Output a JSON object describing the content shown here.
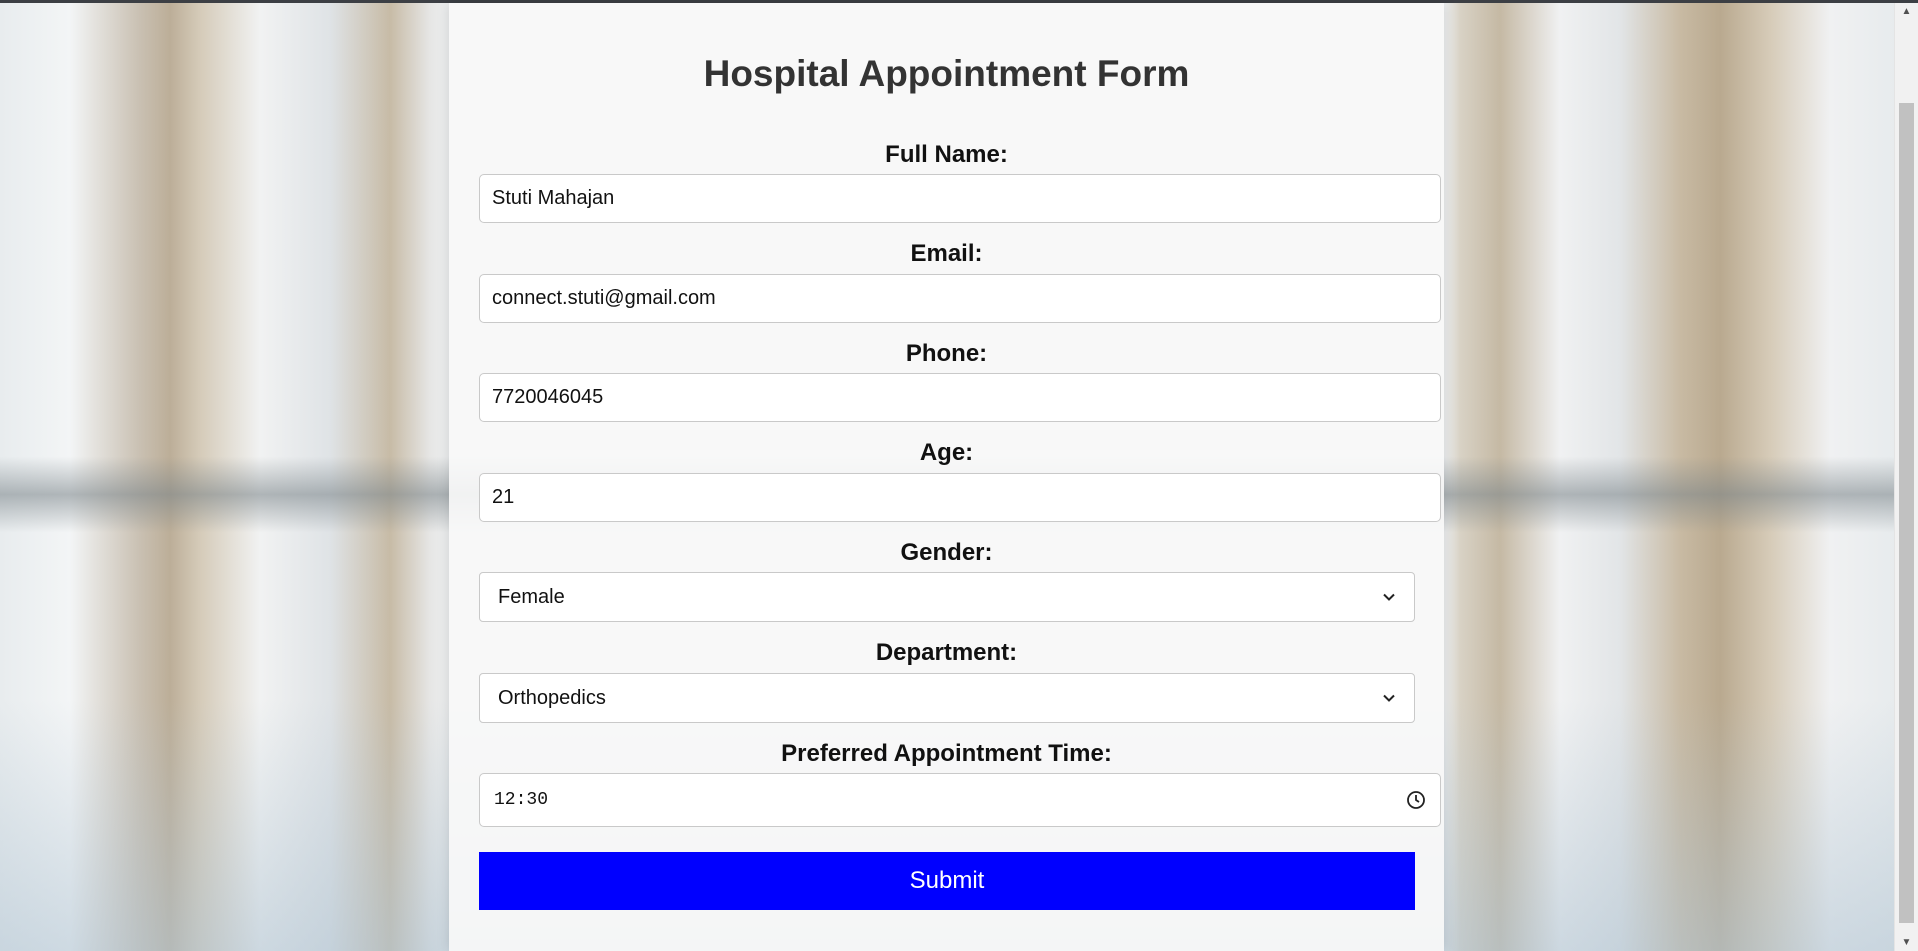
{
  "form": {
    "title": "Hospital Appointment Form",
    "full_name": {
      "label": "Full Name:",
      "value": "Stuti Mahajan"
    },
    "email": {
      "label": "Email:",
      "value": "connect.stuti@gmail.com"
    },
    "phone": {
      "label": "Phone:",
      "value": "7720046045"
    },
    "age": {
      "label": "Age:",
      "value": "21"
    },
    "gender": {
      "label": "Gender:",
      "selected": "Female"
    },
    "department": {
      "label": "Department:",
      "selected": "Orthopedics"
    },
    "time": {
      "label": "Preferred Appointment Time:",
      "value": "12:30"
    },
    "submit_label": "Submit"
  },
  "icons": {
    "select_arrow": "chevron-down-icon",
    "time_picker": "clock-icon"
  },
  "colors": {
    "submit_background": "#0000ff",
    "submit_text": "#ffffff"
  }
}
